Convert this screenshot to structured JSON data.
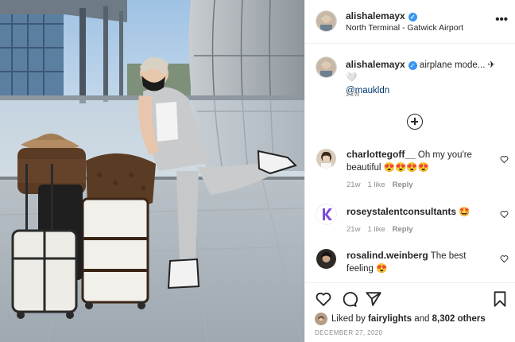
{
  "post": {
    "username": "alishalemayx",
    "location": "North Terminal - Gatwick Airport"
  },
  "caption": {
    "username": "alishalemayx",
    "text": "airplane mode... ✈🤍",
    "mention": "@maukldn",
    "time": "21w"
  },
  "comments": [
    {
      "username": "charlottegoff__",
      "text": "Oh my you're beautiful 😍😍😍😍",
      "time": "21w",
      "likes": "1 like",
      "reply": "Reply"
    },
    {
      "username": "roseystalentconsultants",
      "text": "🤩",
      "time": "21w",
      "likes": "1 like",
      "reply": "Reply"
    },
    {
      "username": "rosalind.weinberg",
      "text": "The best feeling 😍"
    }
  ],
  "likes": {
    "prefix": "Liked by",
    "user": "fairylights",
    "joiner": "and",
    "others": "8,302 others"
  },
  "date": "DECEMBER 27, 2020",
  "icons": [
    "verified-badge",
    "more-options-icon",
    "add-comment-icon",
    "heart-icon",
    "comment-icon",
    "share-icon",
    "bookmark-icon"
  ],
  "colors": {
    "verified": "#3897f0",
    "mention": "#00376b",
    "muted": "#8e8e8e",
    "text": "#262626"
  }
}
